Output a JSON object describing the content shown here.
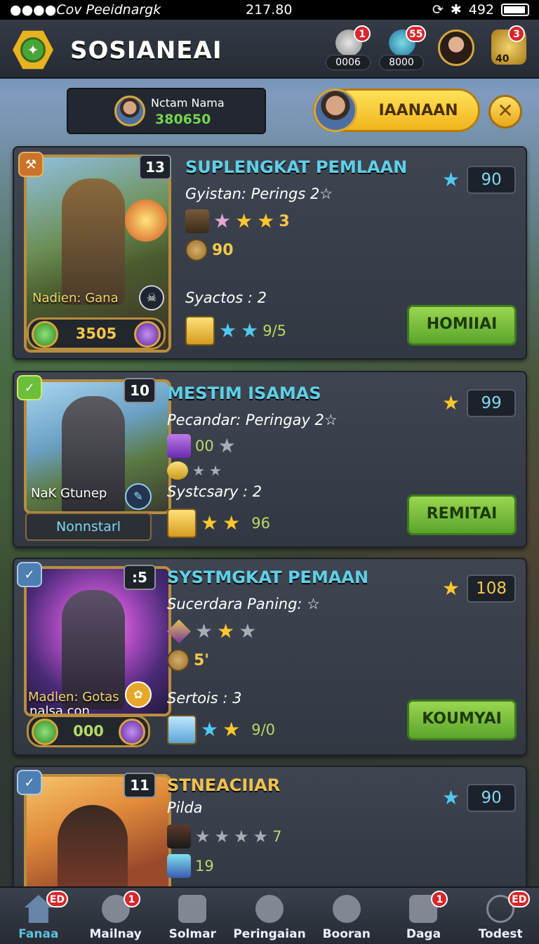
{
  "status_bar": {
    "carrier": "●●●●Cov Peeidnargk",
    "time": "217.80",
    "battery": "492"
  },
  "header": {
    "title": "SOSIANEAI",
    "resources": [
      {
        "icon": "feather-icon",
        "value": "0006",
        "badge": "1"
      },
      {
        "icon": "orb-icon",
        "value": "8000",
        "badge": "55"
      },
      {
        "icon": "portrait-icon",
        "value": "",
        "badge": ""
      },
      {
        "icon": "pouch-icon",
        "value": "40",
        "badge": "3"
      }
    ]
  },
  "profile": {
    "name": "Nctam Nama",
    "score": "380650"
  },
  "action_button": {
    "label": "IAANAAN"
  },
  "cards": [
    {
      "level": "13",
      "title": "SUPLENGKAT PEMLAAN",
      "subtitle": "Gyistan: Perings 2☆",
      "row1_value": "3",
      "row2_value": "90",
      "stat_line": "Syactos : 2",
      "row3_value": "9/5",
      "score": "90",
      "button": "HOMIIAI",
      "art_label": "Nadien: Gana",
      "foot_value": "3505"
    },
    {
      "level": "10",
      "title": "MESTIM ISAMAS",
      "subtitle": "Pecandar: Peringay 2☆",
      "row1_value": "00",
      "stat_line": "Systcsary : 2",
      "row3_value": "96",
      "score": "99",
      "button": "REMITAI",
      "art_label": "NaK Gtunep",
      "plate": "Nonnstarl"
    },
    {
      "level": ":5",
      "title": "SYSTMGKAT PEMAAN",
      "subtitle": "Sucerdara Paning: ☆",
      "row2_value": "5'",
      "stat_line": "Sertois : 3",
      "row3_value": "9/0",
      "score": "108",
      "button": "KOUMYAI",
      "art_label": "Madlen: Gotas",
      "art_label2": "nalsa.con",
      "foot_value": "000"
    },
    {
      "level": "11",
      "title": "STNEACIIAR",
      "subtitle": "Pilda",
      "row1_value": "7",
      "row2_value": "19",
      "score": "90"
    }
  ],
  "nav": [
    {
      "label": "Fanaa",
      "badge": "ED"
    },
    {
      "label": "Mailnay",
      "badge": "1"
    },
    {
      "label": "Solmar",
      "badge": ""
    },
    {
      "label": "Peringaian",
      "badge": ""
    },
    {
      "label": "Booran",
      "badge": ""
    },
    {
      "label": "Daga",
      "badge": "1"
    },
    {
      "label": "Todest",
      "badge": "ED"
    }
  ]
}
